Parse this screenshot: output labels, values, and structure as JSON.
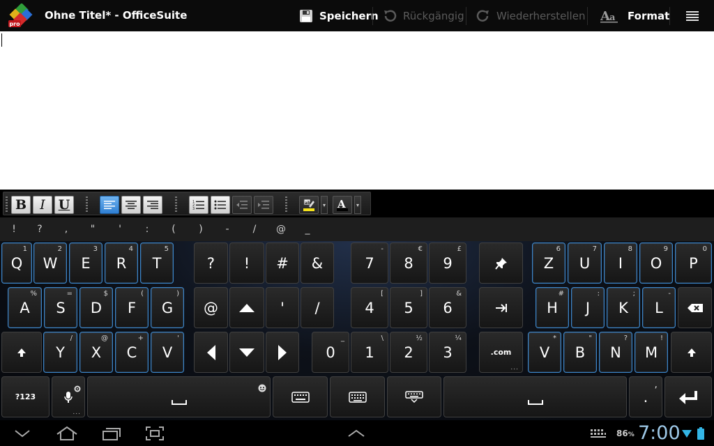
{
  "app": {
    "title": "Ohne Titel* - OfficeSuite",
    "logo_icon": "officesuite-pro-logo-icon"
  },
  "actionbar": {
    "save_label": "Speichern",
    "undo_label": "Rückgängig",
    "redo_label": "Wiederherstellen",
    "format_label": "Format",
    "menu_icon": "overflow-menu-icon"
  },
  "toolbar": {
    "bold": "B",
    "italic": "I",
    "underline": "U",
    "active_alignment": "align-left"
  },
  "symbols": [
    "!",
    "?",
    ",",
    "\"",
    "'",
    ":",
    "(",
    ")",
    "-",
    "/",
    "@",
    "_"
  ],
  "keyboard": {
    "row1_left": [
      {
        "main": "Q",
        "sub": "1"
      },
      {
        "main": "W",
        "sub": "2"
      },
      {
        "main": "E",
        "sub": "3"
      },
      {
        "main": "R",
        "sub": "4"
      },
      {
        "main": "T",
        "sub": "5"
      }
    ],
    "row1_mid": [
      {
        "main": "?"
      },
      {
        "main": "!"
      },
      {
        "main": "#"
      },
      {
        "main": "&"
      }
    ],
    "row1_num": [
      {
        "main": "7",
        "sub": "-"
      },
      {
        "main": "8",
        "sub": "€"
      },
      {
        "main": "9",
        "sub": "£"
      }
    ],
    "row1_right": [
      {
        "main": "Z",
        "sub": "6"
      },
      {
        "main": "U",
        "sub": "7"
      },
      {
        "main": "I",
        "sub": "8"
      },
      {
        "main": "O",
        "sub": "9"
      },
      {
        "main": "P",
        "sub": "0"
      }
    ],
    "row2_left": [
      {
        "main": "A",
        "sub": "%"
      },
      {
        "main": "S",
        "sub": "="
      },
      {
        "main": "D",
        "sub": "$"
      },
      {
        "main": "F",
        "sub": "("
      },
      {
        "main": "G",
        "sub": ")"
      }
    ],
    "row2_mid": [
      {
        "main": "@"
      },
      {
        "main": "'"
      },
      {
        "main": "/"
      }
    ],
    "row2_num": [
      {
        "main": "4",
        "sub": "["
      },
      {
        "main": "5",
        "sub": "]"
      },
      {
        "main": "6",
        "sub": "&"
      }
    ],
    "row2_right": [
      {
        "main": "H",
        "sub": "#"
      },
      {
        "main": "J",
        "sub": ":"
      },
      {
        "main": "K",
        "sub": ";"
      },
      {
        "main": "L",
        "sub": "-"
      }
    ],
    "row3_left": [
      {
        "main": "Y",
        "sub": "/"
      },
      {
        "main": "X",
        "sub": "@"
      },
      {
        "main": "C",
        "sub": "+"
      },
      {
        "main": "V",
        "sub": "'"
      }
    ],
    "row3_num": [
      {
        "main": "0",
        "sub": "_"
      },
      {
        "main": "1",
        "sub": "\\"
      },
      {
        "main": "2",
        "sub": "½"
      },
      {
        "main": "3",
        "sub": "¼"
      }
    ],
    "row3_right": [
      {
        "main": "V",
        "sub": "*"
      },
      {
        "main": "B",
        "sub": "\""
      },
      {
        "main": "N",
        "sub": "?"
      },
      {
        "main": "M",
        "sub": "!"
      }
    ],
    "dotcom": ".com",
    "mode_label": "?123",
    "dot_label": ".",
    "dot_sub": ","
  },
  "status": {
    "battery_percent": "86",
    "battery_unit": "%",
    "time": "7:00"
  }
}
